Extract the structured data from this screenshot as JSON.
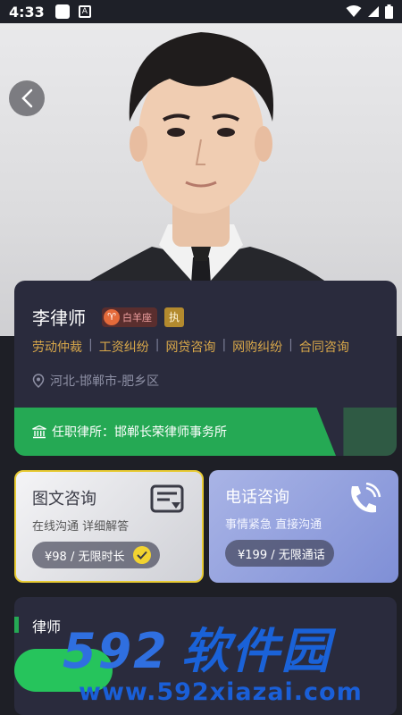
{
  "status_bar": {
    "time": "4:33",
    "notification_icon_name": "a-icon",
    "icons": [
      "wifi-icon",
      "signal-icon",
      "battery-icon"
    ]
  },
  "hero": {
    "back_icon": "chevron-left-icon"
  },
  "profile": {
    "name": "李律师",
    "zodiac": "白羊座",
    "zodiac_symbol": "♈",
    "cert_badge": "执",
    "tags": [
      "劳动仲裁",
      "工资纠纷",
      "网贷咨询",
      "网购纠纷",
      "合同咨询"
    ],
    "tag_separator": "|",
    "location": "河北-邯郸市-肥乡区",
    "firm_label": "任职律所：邯郸长荣律师事务所"
  },
  "consult": {
    "text": {
      "title": "图文咨询",
      "subtitle": "在线沟通 详细解答",
      "price": "¥98 / 无限时长",
      "selected": true
    },
    "phone": {
      "title": "电话咨询",
      "subtitle": "事情紧急 直接沟通",
      "price": "¥199 / 无限通话"
    }
  },
  "intro": {
    "label": "律师"
  },
  "watermark": {
    "logo_num": "592",
    "logo_cn": "软件园",
    "url": "www.592xiazai.com"
  },
  "colors": {
    "accent_green": "#25a954",
    "gold_tag": "#d9a84a",
    "selected_border": "#e8cb34",
    "card_bg": "#2a2b3d"
  }
}
